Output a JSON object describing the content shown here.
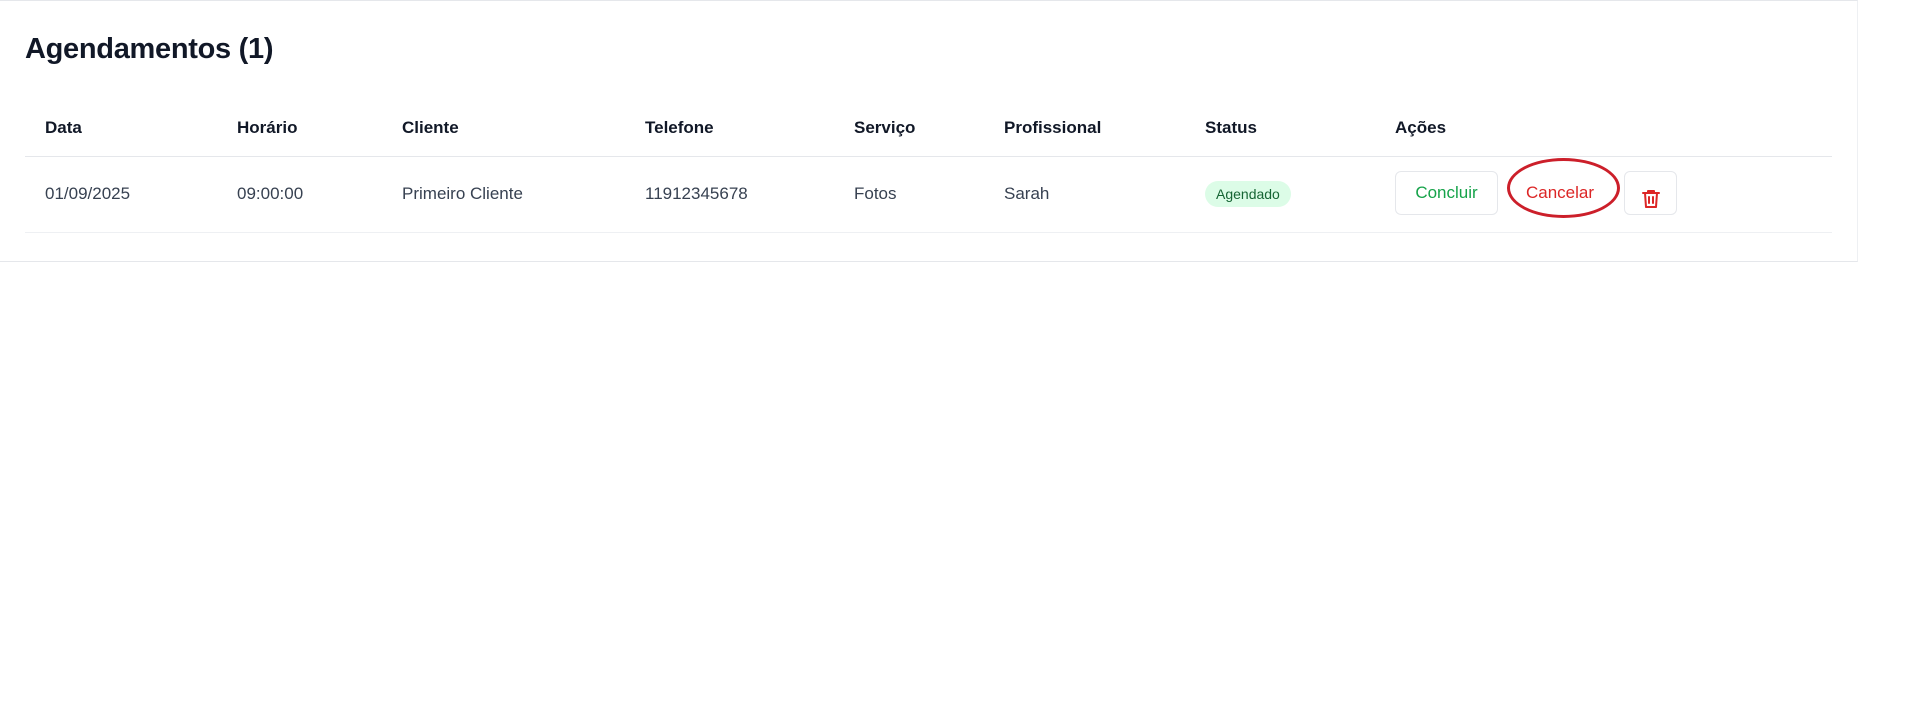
{
  "section": {
    "title": "Agendamentos (1)"
  },
  "table": {
    "headers": {
      "data": "Data",
      "horario": "Horário",
      "cliente": "Cliente",
      "telefone": "Telefone",
      "servico": "Serviço",
      "profissional": "Profissional",
      "status": "Status",
      "acoes": "Ações"
    },
    "rows": [
      {
        "data": "01/09/2025",
        "horario": "09:00:00",
        "cliente": "Primeiro Cliente",
        "telefone": "11912345678",
        "servico": "Fotos",
        "profissional": "Sarah",
        "status": "Agendado",
        "actions": {
          "complete_label": "Concluir",
          "cancel_label": "Cancelar",
          "delete_icon": "trash-icon"
        }
      }
    ]
  },
  "colors": {
    "status_badge_bg": "#dcfce7",
    "status_badge_text": "#166534",
    "complete_text": "#16a34a",
    "cancel_text": "#dc2626",
    "annotation_ring": "#cc1f2a"
  }
}
